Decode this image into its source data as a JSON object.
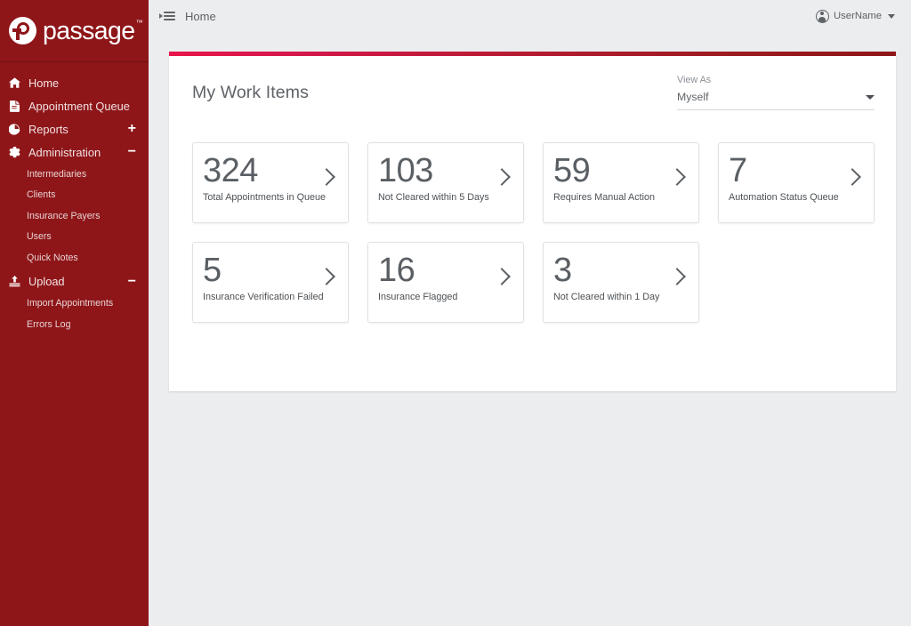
{
  "brand": {
    "name": "passage",
    "trademark": "™",
    "logo_icon": "passage-circle-p-logo"
  },
  "sidebar": {
    "items": [
      {
        "label": "Home",
        "icon": "home-icon",
        "expander": "",
        "active": true
      },
      {
        "label": "Appointment Queue",
        "icon": "document-icon",
        "expander": ""
      },
      {
        "label": "Reports",
        "icon": "pie-chart-icon",
        "expander": "+"
      },
      {
        "label": "Administration",
        "icon": "gear-icon",
        "expander": "−"
      }
    ],
    "admin_subitems": [
      {
        "label": "Intermediaries"
      },
      {
        "label": "Clients"
      },
      {
        "label": "Insurance Payers"
      },
      {
        "label": "Users"
      },
      {
        "label": "Quick Notes"
      }
    ],
    "upload": {
      "label": "Upload",
      "icon": "upload-icon",
      "expander": "−"
    },
    "upload_subitems": [
      {
        "label": "Import Appointments"
      },
      {
        "label": "Errors Log"
      }
    ]
  },
  "topbar": {
    "menu_toggle_icon": "hamburger-menu-icon",
    "expand_icon": "triangle-right-icon",
    "breadcrumb": "Home",
    "user": {
      "name": "UserName",
      "avatar_icon": "user-avatar-icon",
      "caret_icon": "chevron-down-icon"
    }
  },
  "panel": {
    "title": "My Work Items",
    "accent_from": "#e8154a",
    "accent_to": "#8e1619",
    "view_as": {
      "label": "View As",
      "value": "Myself",
      "caret_icon": "chevron-down-icon",
      "options": [
        "Myself"
      ]
    }
  },
  "work_items": [
    {
      "value": "324",
      "label": "Total Appointments in Queue",
      "chevron_icon": "chevron-right-icon"
    },
    {
      "value": "103",
      "label": "Not Cleared within 5 Days",
      "chevron_icon": "chevron-right-icon"
    },
    {
      "value": "59",
      "label": "Requires Manual Action",
      "chevron_icon": "chevron-right-icon"
    },
    {
      "value": "7",
      "label": "Automation Status Queue",
      "chevron_icon": "chevron-right-icon"
    },
    {
      "value": "5",
      "label": "Insurance Verification Failed",
      "chevron_icon": "chevron-right-icon"
    },
    {
      "value": "16",
      "label": "Insurance Flagged",
      "chevron_icon": "chevron-right-icon"
    },
    {
      "value": "3",
      "label": "Not Cleared within 1 Day",
      "chevron_icon": "chevron-right-icon"
    }
  ],
  "theme": {
    "sidebar_bg": "#8e1619",
    "page_bg": "#ecedef",
    "panel_bg": "#ffffff",
    "text_muted": "#5f6368"
  }
}
